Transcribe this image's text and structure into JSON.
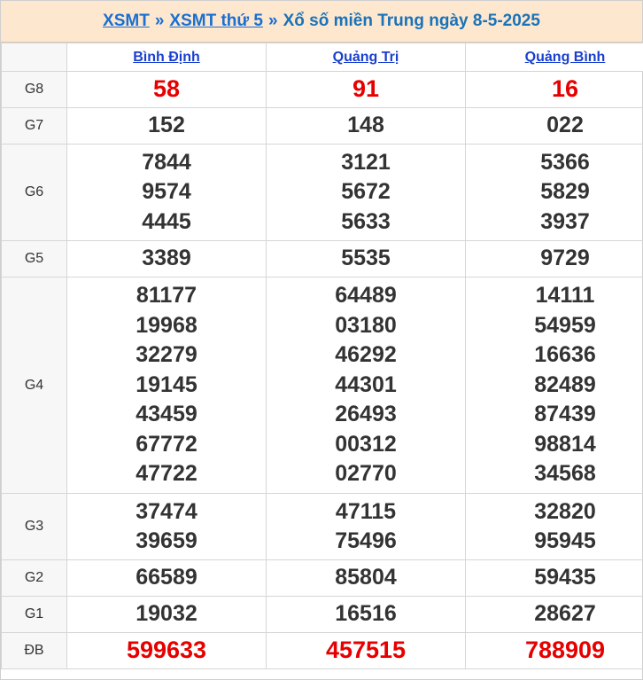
{
  "header": {
    "link1": "XSMT",
    "sep1": "»",
    "link2": "XSMT thứ 5",
    "sep2": "»",
    "title": "Xổ số miền Trung ngày 8-5-2025"
  },
  "provinces": [
    "Bình Định",
    "Quảng Trị",
    "Quảng Bình"
  ],
  "rows": [
    {
      "label": "G8",
      "values": [
        [
          "58"
        ],
        [
          "91"
        ],
        [
          "16"
        ]
      ]
    },
    {
      "label": "G7",
      "values": [
        [
          "152"
        ],
        [
          "148"
        ],
        [
          "022"
        ]
      ]
    },
    {
      "label": "G6",
      "values": [
        [
          "7844",
          "9574",
          "4445"
        ],
        [
          "3121",
          "5672",
          "5633"
        ],
        [
          "5366",
          "5829",
          "3937"
        ]
      ]
    },
    {
      "label": "G5",
      "values": [
        [
          "3389"
        ],
        [
          "5535"
        ],
        [
          "9729"
        ]
      ]
    },
    {
      "label": "G4",
      "values": [
        [
          "81177",
          "19968",
          "32279",
          "19145",
          "43459",
          "67772",
          "47722"
        ],
        [
          "64489",
          "03180",
          "46292",
          "44301",
          "26493",
          "00312",
          "02770"
        ],
        [
          "14111",
          "54959",
          "16636",
          "82489",
          "87439",
          "98814",
          "34568"
        ]
      ]
    },
    {
      "label": "G3",
      "values": [
        [
          "37474",
          "39659"
        ],
        [
          "47115",
          "75496"
        ],
        [
          "32820",
          "95945"
        ]
      ]
    },
    {
      "label": "G2",
      "values": [
        [
          "66589"
        ],
        [
          "85804"
        ],
        [
          "59435"
        ]
      ]
    },
    {
      "label": "G1",
      "values": [
        [
          "19032"
        ],
        [
          "16516"
        ],
        [
          "28627"
        ]
      ]
    },
    {
      "label": "ĐB",
      "values": [
        [
          "599633"
        ],
        [
          "457515"
        ],
        [
          "788909"
        ]
      ]
    }
  ],
  "colors": {
    "accent": "#1a6fd0",
    "highlight": "#e60000",
    "header_bg": "#fde7cf"
  }
}
